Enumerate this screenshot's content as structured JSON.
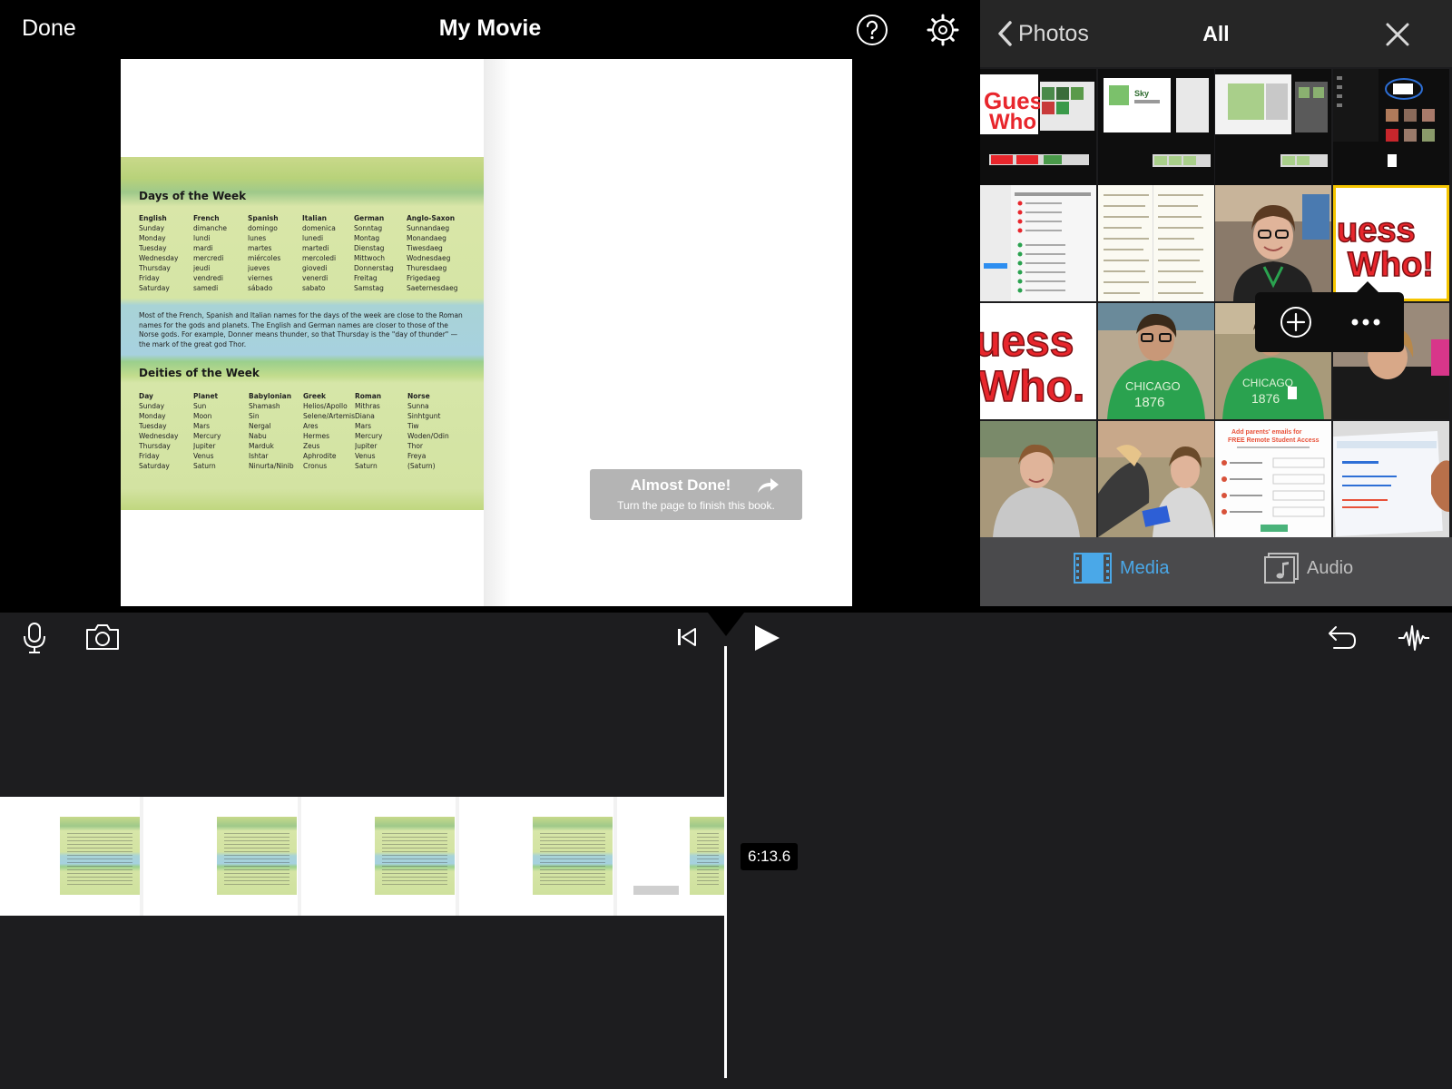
{
  "header": {
    "done_label": "Done",
    "title": "My Movie"
  },
  "book": {
    "days_heading": "Days of the Week",
    "days_columns": [
      "English",
      "French",
      "Spanish",
      "Italian",
      "German",
      "Anglo-Saxon"
    ],
    "days_rows": [
      [
        "Sunday",
        "dimanche",
        "domingo",
        "domenica",
        "Sonntag",
        "Sunnandaeg"
      ],
      [
        "Monday",
        "lundi",
        "lunes",
        "lunedi",
        "Montag",
        "Monandaeg"
      ],
      [
        "Tuesday",
        "mardi",
        "martes",
        "martedi",
        "Dienstag",
        "Tiwesdaeg"
      ],
      [
        "Wednesday",
        "mercredi",
        "miércoles",
        "mercoledi",
        "Mittwoch",
        "Wodnesdaeg"
      ],
      [
        "Thursday",
        "jeudi",
        "jueves",
        "giovedi",
        "Donnerstag",
        "Thuresdaeg"
      ],
      [
        "Friday",
        "vendredi",
        "viernes",
        "venerdi",
        "Freitag",
        "Frigedaeg"
      ],
      [
        "Saturday",
        "samedi",
        "sábado",
        "sabato",
        "Samstag",
        "Saeternesdaeg"
      ]
    ],
    "paragraph": "Most of the French, Spanish and Italian names for the days of the week are close to the Roman names for the gods and planets. The English and German names are closer to those of the Norse gods. For example, Donner means thunder, so that Thursday is the \"day of thunder\" — the mark of the great god Thor.",
    "deities_heading": "Deities of the Week",
    "deities_columns": [
      "Day",
      "Planet",
      "Babylonian",
      "Greek",
      "Roman",
      "Norse"
    ],
    "deities_rows": [
      [
        "Sunday",
        "Sun",
        "Shamash",
        "Helios/Apollo",
        "Mithras",
        "Sunna"
      ],
      [
        "Monday",
        "Moon",
        "Sin",
        "Selene/Artemis",
        "Diana",
        "Sinhtgunt"
      ],
      [
        "Tuesday",
        "Mars",
        "Nergal",
        "Ares",
        "Mars",
        "Tiw"
      ],
      [
        "Wednesday",
        "Mercury",
        "Nabu",
        "Hermes",
        "Mercury",
        "Woden/Odin"
      ],
      [
        "Thursday",
        "Jupiter",
        "Marduk",
        "Zeus",
        "Jupiter",
        "Thor"
      ],
      [
        "Friday",
        "Venus",
        "Ishtar",
        "Aphrodite",
        "Venus",
        "Freya"
      ],
      [
        "Saturday",
        "Saturn",
        "Ninurta/Ninib",
        "Cronus",
        "Saturn",
        "(Saturn)"
      ]
    ]
  },
  "overlay": {
    "title": "Almost Done!",
    "subtitle": "Turn the page to finish this book."
  },
  "browser": {
    "back_label": "Photos",
    "title": "All",
    "tabs": {
      "media_label": "Media",
      "audio_label": "Audio"
    },
    "popover": {
      "add_icon": "plus-circle-icon",
      "more_icon": "ellipsis-icon"
    }
  },
  "timeline": {
    "time": "6:13.6"
  },
  "colors": {
    "accent": "#4aa8e8",
    "selection": "#f5c500"
  }
}
